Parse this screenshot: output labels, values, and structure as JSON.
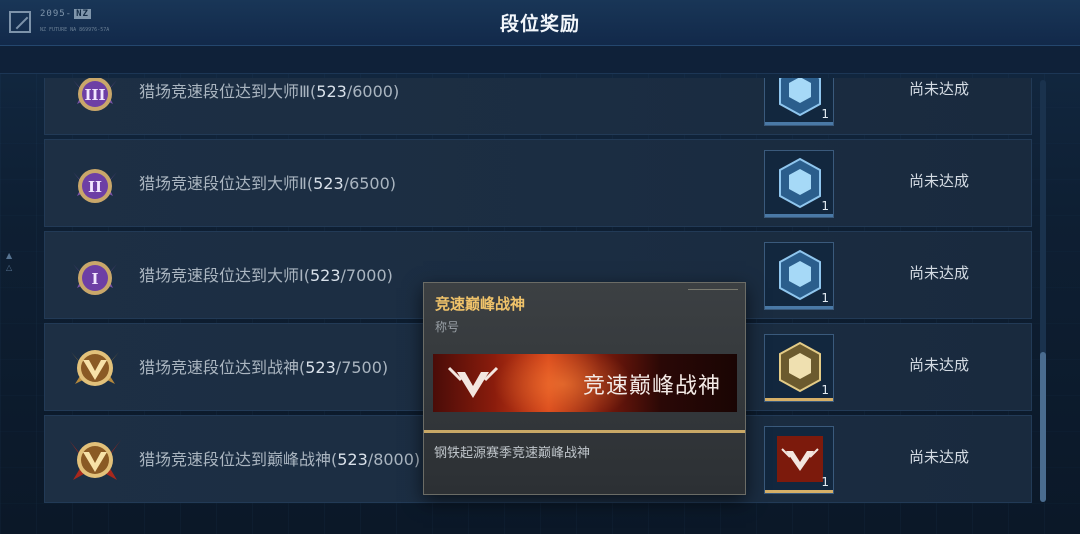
{
  "header": {
    "title": "段位奖励",
    "logo_code": "2095-",
    "logo_tag": "NZ",
    "logo_sub": "NZ FUTURE NA 869976-57A"
  },
  "rows": [
    {
      "label": "猎场竞速段位达到大师Ⅲ(",
      "current": "523",
      "target": "/6000)",
      "status": "尚未达成",
      "badge": "master-3-badge",
      "reward_count": "1",
      "reward_color": "#4a79a6"
    },
    {
      "label": "猎场竞速段位达到大师Ⅱ(",
      "current": "523",
      "target": "/6500)",
      "status": "尚未达成",
      "badge": "master-2-badge",
      "reward_count": "1",
      "reward_color": "#4a79a6"
    },
    {
      "label": "猎场竞速段位达到大师Ⅰ(",
      "current": "523",
      "target": "/7000)",
      "status": "尚未达成",
      "badge": "master-1-badge",
      "reward_count": "1",
      "reward_color": "#4a79a6"
    },
    {
      "label": "猎场竞速段位达到战神(",
      "current": "523",
      "target": "/7500)",
      "status": "尚未达成",
      "badge": "war-god-badge",
      "reward_count": "1",
      "reward_color": "#d6b068"
    },
    {
      "label": "猎场竞速段位达到巅峰战神(",
      "current": "523",
      "target": "/8000)",
      "status": "尚未达成",
      "badge": "peak-war-god-badge",
      "reward_count": "1",
      "reward_color": "#d6b068"
    }
  ],
  "tooltip": {
    "title": "竞速巅峰战神",
    "type": "称号",
    "banner_text": "竞速巅峰战神",
    "description": "钢铁起源赛季竞速巅峰战神"
  },
  "colors": {
    "accent_gold": "#f0c36a",
    "reward_blue": "#4a79a6",
    "reward_gold": "#d6b068"
  }
}
